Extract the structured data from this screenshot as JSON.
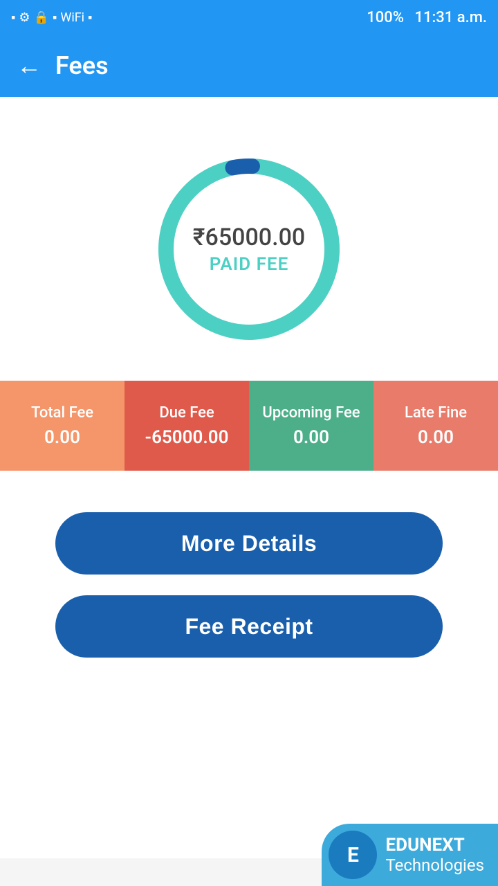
{
  "statusBar": {
    "time": "11:31 a.m.",
    "battery": "100%"
  },
  "toolbar": {
    "title": "Fees",
    "back_label": "←"
  },
  "chart": {
    "amount": "₹65000.00",
    "label": "PAID FEE",
    "total_circumference": 880,
    "paid_dash": 855,
    "unpaid_dash": 25,
    "ring_color_main": "#4DD0C4",
    "ring_color_accent": "#1A5FAC"
  },
  "feeSummary": [
    {
      "label": "Total Fee",
      "value": "0.00",
      "color_class": "total"
    },
    {
      "label": "Due Fee",
      "value": "-65000.00",
      "color_class": "due"
    },
    {
      "label": "Upcoming Fee",
      "value": "0.00",
      "color_class": "upcoming"
    },
    {
      "label": "Late Fine",
      "value": "0.00",
      "color_class": "late"
    }
  ],
  "buttons": {
    "more_details": "More Details",
    "fee_receipt": "Fee Receipt"
  },
  "brand": {
    "name": "EDUNEXT",
    "sub": "Technologies",
    "logo_symbol": "E"
  }
}
